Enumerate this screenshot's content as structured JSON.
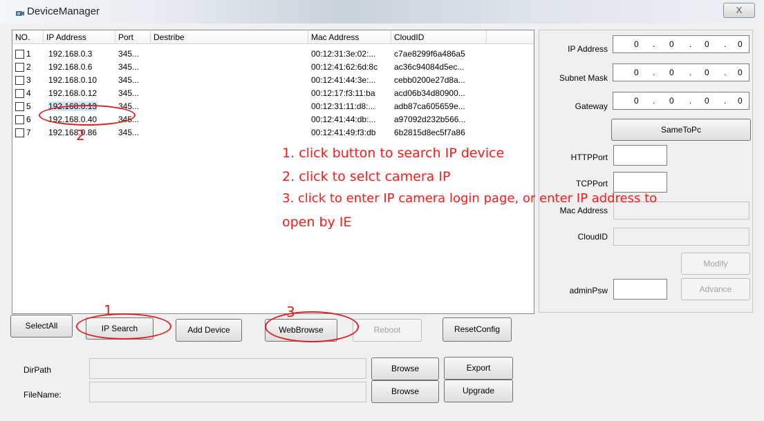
{
  "window": {
    "title": "DeviceManager",
    "close_glyph": "X"
  },
  "list": {
    "columns": [
      "NO.",
      "IP Address",
      "Port",
      "Destribe",
      "Mac Address",
      "CloudID"
    ],
    "rows": [
      {
        "no": "1",
        "ip": "192.168.0.3",
        "port": "345...",
        "mac": "00:12:31:3e:02:...",
        "cloud": "c7ae8299f6a486a5"
      },
      {
        "no": "2",
        "ip": "192.168.0.6",
        "port": "345...",
        "mac": "00:12:41:62:6d:8c",
        "cloud": "ac36c94084d5ec..."
      },
      {
        "no": "3",
        "ip": "192.168.0.10",
        "port": "345...",
        "mac": "00:12:41:44:3e:...",
        "cloud": "cebb0200e27d8a..."
      },
      {
        "no": "4",
        "ip": "192.168.0.12",
        "port": "345...",
        "mac": "00:12:17:f3:11:ba",
        "cloud": "acd06b34d80900..."
      },
      {
        "no": "5",
        "ip": "192.168.0.13",
        "port": "345...",
        "mac": "00:12:31:11:d8:...",
        "cloud": "adb87ca605659e..."
      },
      {
        "no": "6",
        "ip": "192.168.0.40",
        "port": "345...",
        "mac": "00:12:41:44:db:...",
        "cloud": "a97092d232b566..."
      },
      {
        "no": "7",
        "ip": "192.168.0.86",
        "port": "345...",
        "mac": "00:12:41:49:f3:db",
        "cloud": "6b2815d8ec5f7a86"
      }
    ]
  },
  "settings": {
    "ip_label": "IP Address",
    "mask_label": "Subnet Mask",
    "gateway_label": "Gateway",
    "octet": "0",
    "dot": ".",
    "same_btn": "SameToPc",
    "http_label": "HTTPPort",
    "tcp_label": "TCPPort",
    "mac_label": "Mac Address",
    "cloud_label": "CloudID",
    "modify_btn": "Modify",
    "admin_label": "adminPsw",
    "advance_btn": "Advance"
  },
  "toolbar": {
    "selectall": "SelectAll",
    "ipsearch": "IP Search",
    "adddevice": "Add Device",
    "webbrowse": "WebBrowse",
    "reboot": "Reboot",
    "resetconfig": "ResetConfig"
  },
  "files": {
    "dirpath_label": "DirPath",
    "filename_label": "FileName:",
    "browse": "Browse",
    "export": "Export",
    "upgrade": "Upgrade"
  },
  "annotations": {
    "step1": "1. click button to search IP device",
    "step2": "2. click to selct camera IP",
    "step3": "3. click to enter IP camera login page, or enter IP address to",
    "step3b": "open by IE",
    "num1": "1",
    "num2": "2",
    "num3": "3"
  },
  "colors": {
    "annotation": "#ff1a1a"
  }
}
